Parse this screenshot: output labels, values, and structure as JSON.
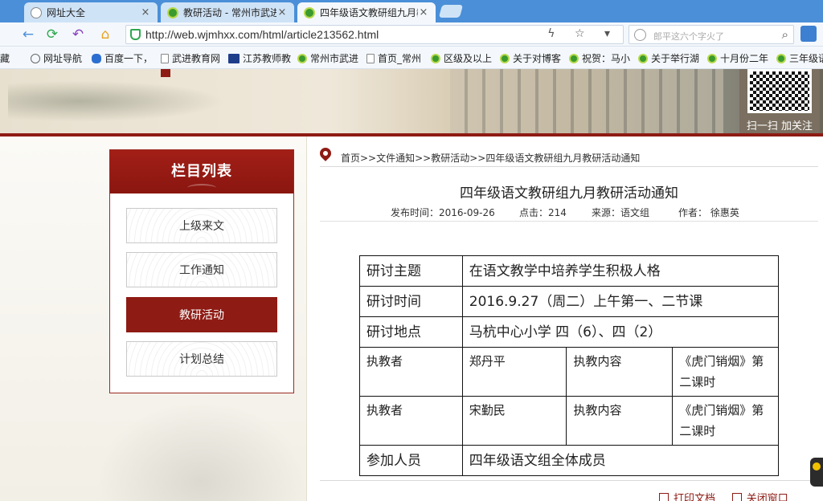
{
  "browser": {
    "tabs": [
      {
        "title": "网址大全",
        "close": "×"
      },
      {
        "title": "教研活动 - 常州市武进区",
        "close": "×"
      },
      {
        "title": "四年级语文教研组九月教",
        "close": "×"
      }
    ],
    "nav": {
      "back": "←",
      "reload": "⟳",
      "undo": "↶",
      "home": "⌂"
    },
    "url": "http://web.wjmhxx.com/html/article213562.html",
    "url_icons": "ϟ ☆ ▾",
    "search_placeholder": "郎平这六个字火了",
    "search_icon": "⌕",
    "bookmarks": [
      {
        "label": "藏",
        "icon": "none"
      },
      {
        "label": "网址导航",
        "icon": "globe"
      },
      {
        "label": "百度一下，",
        "icon": "paw"
      },
      {
        "label": "武进教育网",
        "icon": "page"
      },
      {
        "label": "江苏教师教",
        "icon": "sq"
      },
      {
        "label": "常州市武进",
        "icon": "green"
      },
      {
        "label": "首页_常州",
        "icon": "page"
      },
      {
        "label": "区级及以上",
        "icon": "green"
      },
      {
        "label": "关于对博客",
        "icon": "green"
      },
      {
        "label": "祝贺：马小",
        "icon": "green"
      },
      {
        "label": "关于举行湖",
        "icon": "green"
      },
      {
        "label": "十月份二年",
        "icon": "green"
      },
      {
        "label": "三年级语",
        "icon": "green"
      }
    ]
  },
  "banner": {
    "qr_label": "扫一扫 加关注"
  },
  "sidebar": {
    "title": "栏目列表",
    "items": [
      {
        "label": "上级来文",
        "active": false
      },
      {
        "label": "工作通知",
        "active": false
      },
      {
        "label": "教研活动",
        "active": true
      },
      {
        "label": "计划总结",
        "active": false
      }
    ]
  },
  "article": {
    "breadcrumb": "首页>>文件通知>>教研活动>>四年级语文教研组九月教研活动通知",
    "title": "四年级语文教研组九月教研活动通知",
    "meta": {
      "date": "发布时间：2016-09-26",
      "clicks": "点击：214",
      "source": "来源：语文组",
      "author": "作者： 徐惠英"
    },
    "table": {
      "topic_label": "研讨主题",
      "topic_value": "在语文教学中培养学生积极人格",
      "time_label": "研讨时间",
      "time_value": "2016.9.27（周二）上午第一、二节课",
      "place_label": "研讨地点",
      "place_value": "马杭中心小学 四（6）、四（2）",
      "teachers": [
        {
          "label": "执教者",
          "name": "郑丹平",
          "content_label": "执教内容",
          "content": "《虎门销烟》第二课时"
        },
        {
          "label": "执教者",
          "name": "宋勤民",
          "content_label": "执教内容",
          "content": "《虎门销烟》第二课时"
        }
      ],
      "attendees_label": "参加人员",
      "attendees_value": "四年级语文组全体成员"
    },
    "actions": {
      "print": "打印文档",
      "close": "关闭窗口"
    }
  },
  "colors": {
    "accent": "#8e1b14",
    "tabbar": "#4a8fd8"
  }
}
